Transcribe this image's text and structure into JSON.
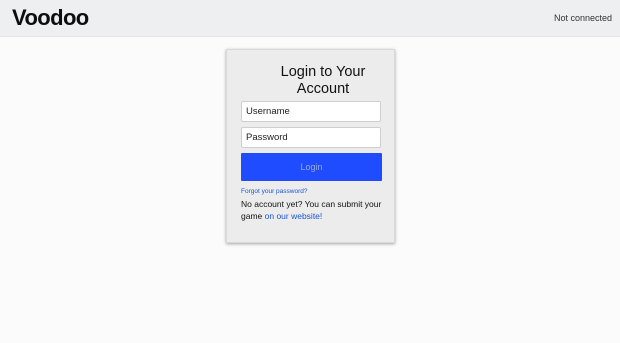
{
  "header": {
    "logo_text": "Voodoo",
    "status_text": "Not connected"
  },
  "login": {
    "title": "Login to Your Account",
    "username_placeholder": "Username",
    "password_placeholder": "Password",
    "submit_label": "Login",
    "forgot_label": "Forgot your password?",
    "signup_text": "No account yet? You can submit your game ",
    "signup_link_label": "on our website!"
  },
  "colors": {
    "header_bg": "#eeeff1",
    "accent_blue": "#1f4cff",
    "link_blue": "#1a55d6",
    "card_bg": "#ececec"
  }
}
